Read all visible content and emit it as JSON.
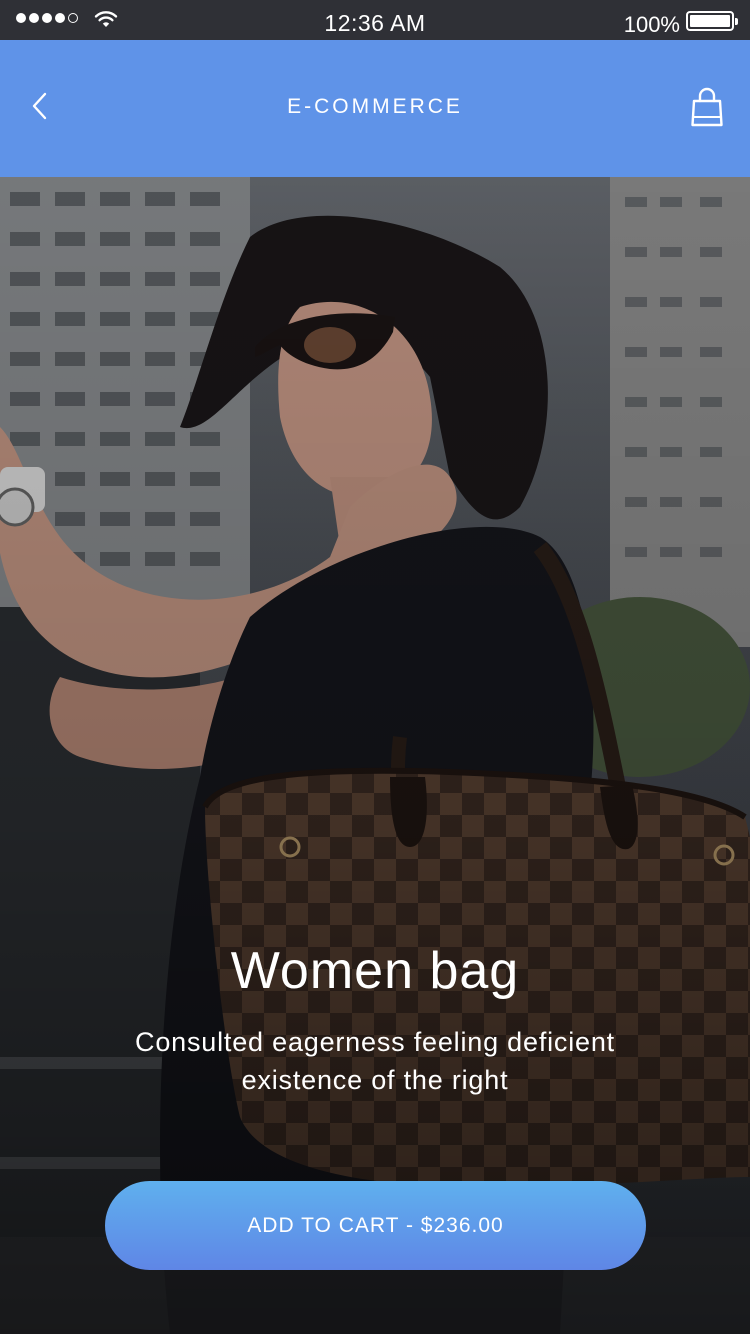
{
  "status_bar": {
    "time": "12:36 AM",
    "battery_percent": "100%",
    "signal_bars": 4,
    "signal_total": 5,
    "icons": [
      "signal-dots-icon",
      "wifi-icon",
      "battery-icon"
    ]
  },
  "nav": {
    "title": "E-COMMERCE",
    "back_icon": "chevron-left-icon",
    "cart_icon": "shopping-bag-icon",
    "background": "#5f93e8"
  },
  "product": {
    "title": "Women bag",
    "description": "Consulted eagerness feeling deficient existence of the right",
    "button_label": "ADD TO CART - $236.00"
  },
  "colors": {
    "accent": "#5f93e8",
    "button_gradient_top": "#5fb0ee",
    "button_gradient_bottom": "#5f86e6",
    "status_bar_bg": "#2f3036"
  }
}
